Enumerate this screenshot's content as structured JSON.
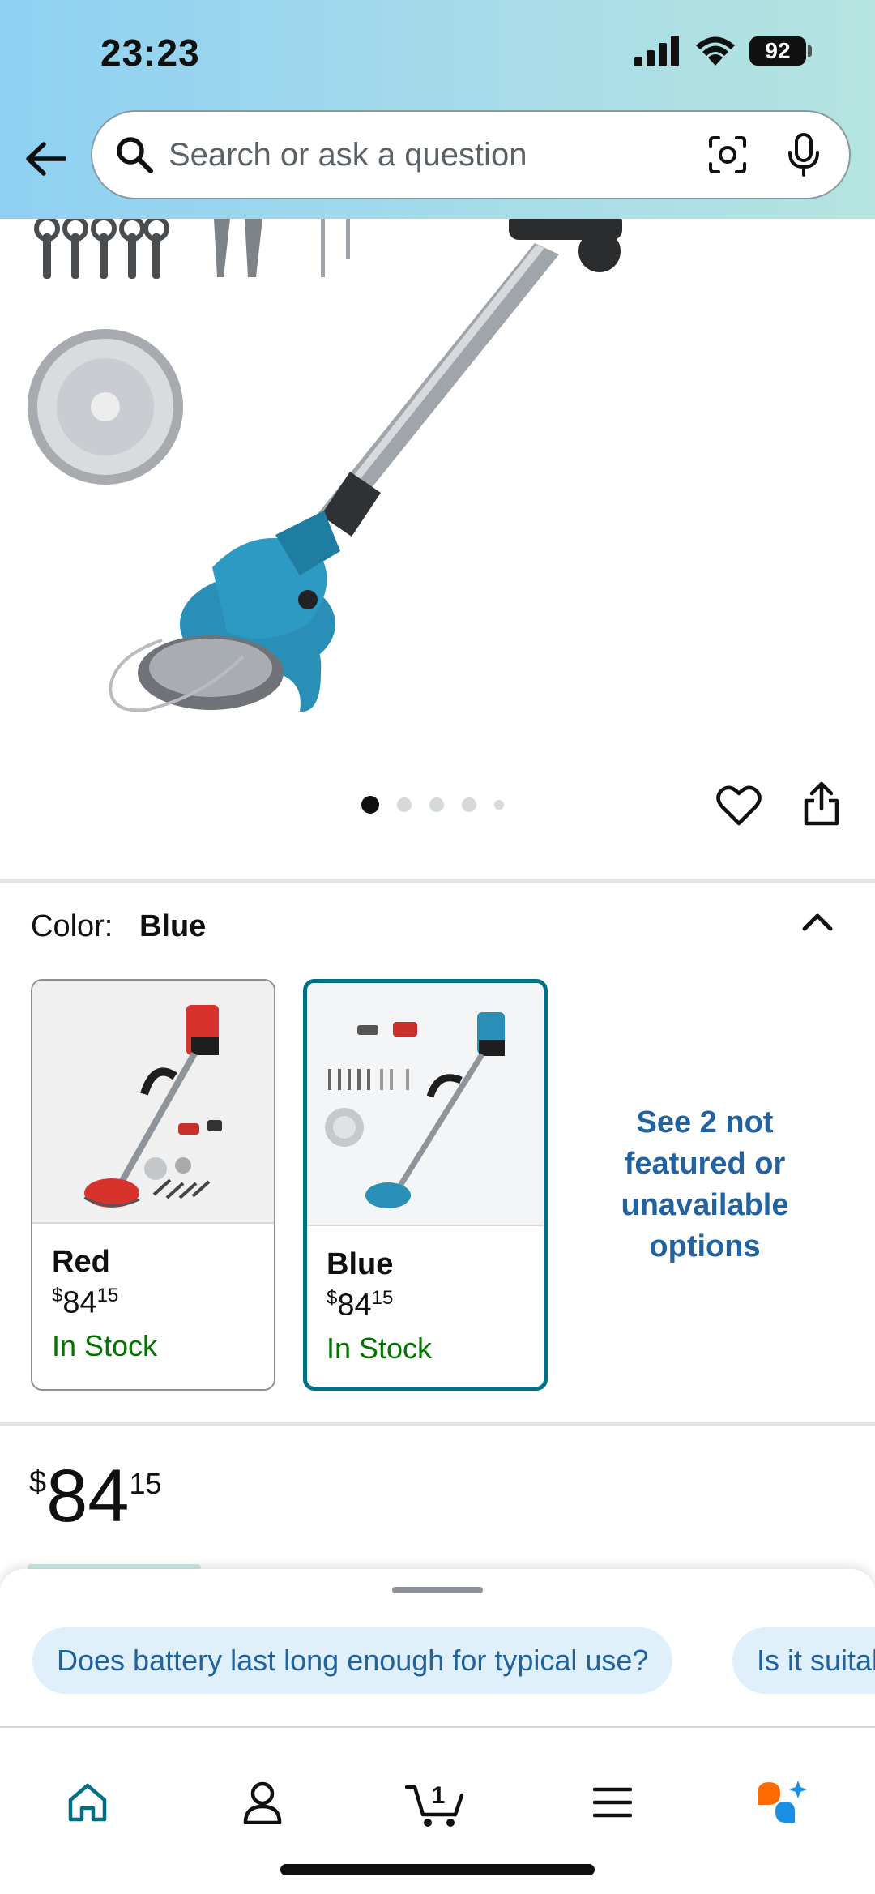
{
  "status_bar": {
    "time": "23:23",
    "battery_level": "92"
  },
  "search": {
    "placeholder": "Search or ask a question"
  },
  "carousel": {
    "total_dots": 5,
    "active_index": 0
  },
  "color_selector": {
    "label": "Color:",
    "selected_value": "Blue",
    "options": [
      {
        "name": "Red",
        "currency": "$",
        "price_whole": "84",
        "price_fraction": "15",
        "availability": "In Stock"
      },
      {
        "name": "Blue",
        "currency": "$",
        "price_whole": "84",
        "price_fraction": "15",
        "availability": "In Stock"
      }
    ],
    "see_more_label": "See 2 not featured or unavailable options"
  },
  "price": {
    "currency": "$",
    "whole": "84",
    "fraction": "15"
  },
  "questions": {
    "chips": [
      "Does battery last long enough for typical use?",
      "Is it suitable for thick weeds?"
    ]
  },
  "tabbar": {
    "cart_count": "1",
    "tabs": [
      "home-icon",
      "account-icon",
      "cart-icon",
      "menu-icon",
      "rufus-ai-icon"
    ]
  },
  "colors": {
    "accent_teal": "#007185",
    "link_blue": "#2162a1",
    "in_stock_green": "#007600",
    "chip_bg": "#dff0fb"
  }
}
